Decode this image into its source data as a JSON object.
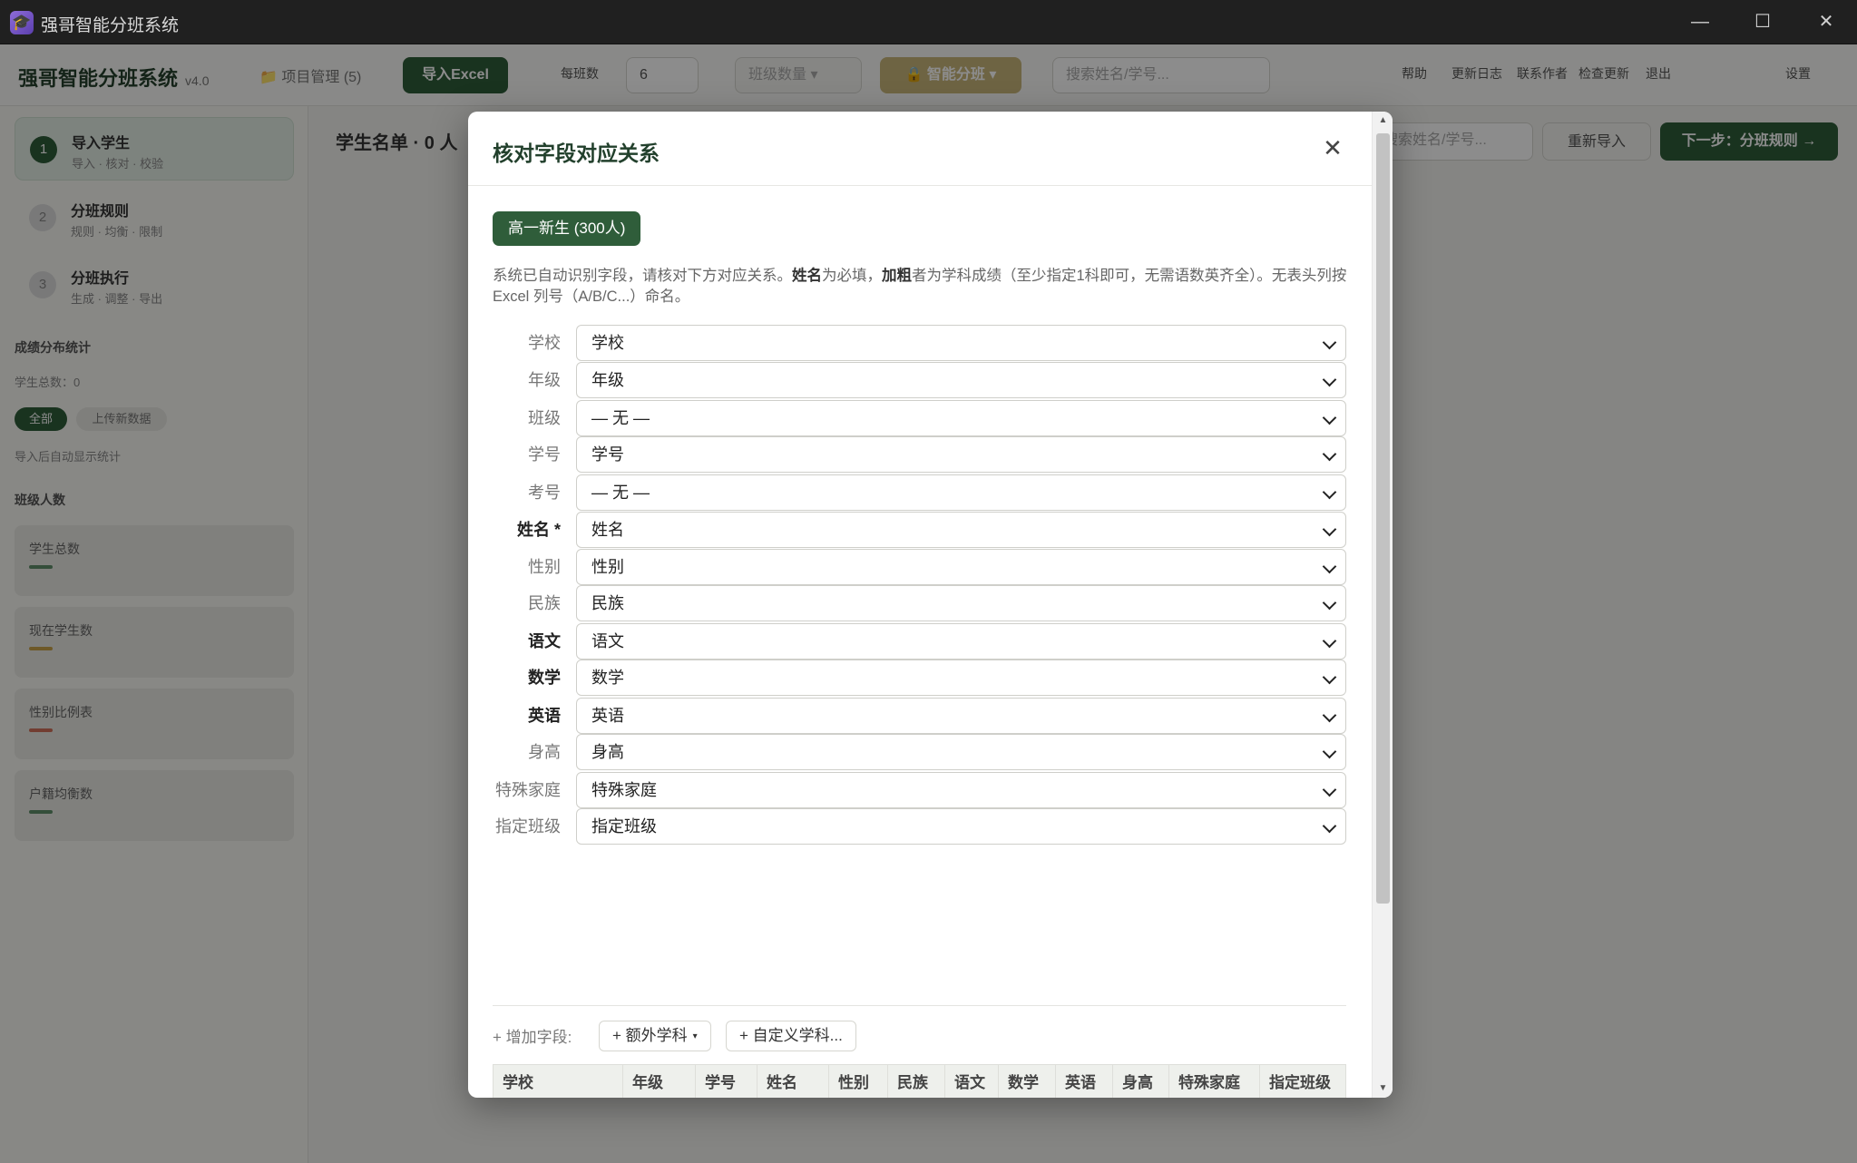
{
  "window": {
    "title": "强哥智能分班系统",
    "controls": {
      "minimize": "—",
      "maximize": "☐",
      "close": "✕"
    }
  },
  "background_app": {
    "brand": "强哥智能分班系统",
    "version": "v4.0",
    "header_link": "📁 项目管理 (5)",
    "header_primary_button": "导入Excel",
    "header_select_label": "每班数",
    "header_select_value": "6",
    "header_disabled_input": "班级数量 ▾",
    "header_gold_button": "🔒 智能分班 ▾",
    "header_search_placeholder": "搜索姓名/学号...",
    "header_chips": [
      "帮助",
      "更新日志",
      "联系作者",
      "检查更新",
      "退出",
      "设置"
    ],
    "sidebar": {
      "steps": [
        {
          "num": "1",
          "title": "导入学生",
          "subtitle": "导入 · 核对 · 校验"
        },
        {
          "num": "2",
          "title": "分班规则",
          "subtitle": "规则 · 均衡 · 限制"
        },
        {
          "num": "3",
          "title": "分班执行",
          "subtitle": "生成 · 调整 · 导出"
        }
      ],
      "section1_heading": "成绩分布统计",
      "section1_text": "学生总数：0",
      "tags": [
        "全部",
        "上传新数据"
      ],
      "section1_note": "导入后自动显示统计",
      "section2_heading": "班级人数",
      "cards": [
        "学生总数",
        "现在学生数",
        "性别比例表",
        "户籍均衡数"
      ]
    },
    "main_heading": "学生名单 · 0 人",
    "main_search_placeholder": "搜索姓名/学号...",
    "main_button_secondary": "重新导入",
    "main_button_primary": "下一步：分班规则 →"
  },
  "modal": {
    "title": "核对字段对应关系",
    "close_label": "✕",
    "sheet_tab": "高一新生 (300人)",
    "intro": {
      "p1": "系统已自动识别字段，请核对下方对应关系。",
      "b1": "姓名",
      "p2": "为必填，",
      "b2": "加粗",
      "p3": "者为学科成绩（至少指定1科即可，无需语数英齐全）。无表头列按 Excel 列号（A/B/C...）命名。"
    },
    "fields": [
      {
        "label": "学校",
        "value": "学校",
        "required": false
      },
      {
        "label": "年级",
        "value": "年级",
        "required": false
      },
      {
        "label": "班级",
        "value": "— 无 —",
        "required": false
      },
      {
        "label": "学号",
        "value": "学号",
        "required": false
      },
      {
        "label": "考号",
        "value": "— 无 —",
        "required": false
      },
      {
        "label": "姓名 *",
        "value": "姓名",
        "required": true
      },
      {
        "label": "性别",
        "value": "性别",
        "required": false
      },
      {
        "label": "民族",
        "value": "民族",
        "required": false
      },
      {
        "label": "语文",
        "value": "语文",
        "required": true
      },
      {
        "label": "数学",
        "value": "数学",
        "required": true
      },
      {
        "label": "英语",
        "value": "英语",
        "required": true
      },
      {
        "label": "身高",
        "value": "身高",
        "required": false
      },
      {
        "label": "特殊家庭",
        "value": "特殊家庭",
        "required": false
      },
      {
        "label": "指定班级",
        "value": "指定班级",
        "required": false
      }
    ],
    "add_field_label": "+ 增加字段:",
    "add_extra_subject": "+ 额外学科",
    "add_extra_caret": "▾",
    "add_custom_subject": "+ 自定义学科...",
    "preview_headers": [
      "学校",
      "年级",
      "学号",
      "姓名",
      "性别",
      "民族",
      "语文",
      "数学",
      "英语",
      "身高",
      "特殊家庭",
      "指定班级"
    ],
    "scroll_up": "▲",
    "scroll_down": "▼"
  },
  "colors": {
    "accent_green": "#2f5d3a",
    "title_green": "#22402c",
    "gold": "#c9b67a"
  }
}
